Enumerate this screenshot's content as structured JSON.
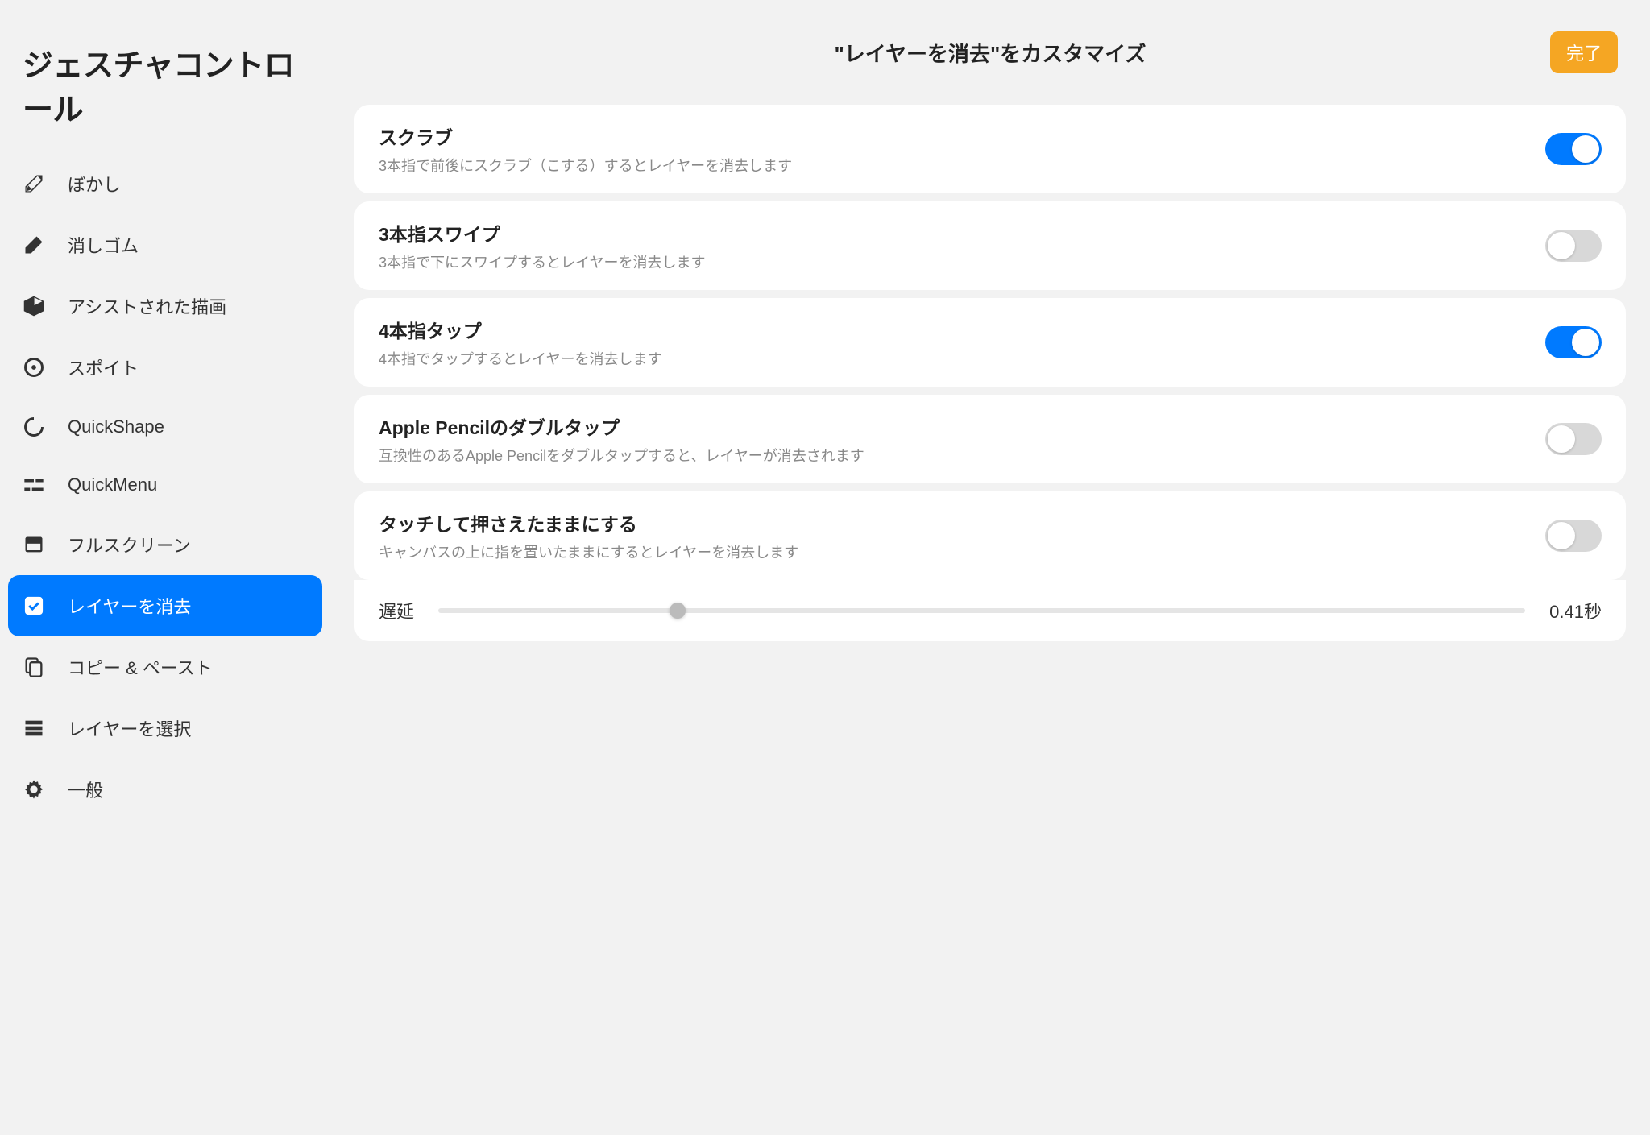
{
  "sidebar": {
    "title": "ジェスチャコントロール",
    "items": [
      {
        "id": "blur",
        "label": "ぼかし"
      },
      {
        "id": "eraser",
        "label": "消しゴム"
      },
      {
        "id": "assisted-draw",
        "label": "アシストされた描画"
      },
      {
        "id": "eyedropper",
        "label": "スポイト"
      },
      {
        "id": "quickshape",
        "label": "QuickShape"
      },
      {
        "id": "quickmenu",
        "label": "QuickMenu"
      },
      {
        "id": "fullscreen",
        "label": "フルスクリーン"
      },
      {
        "id": "clear-layer",
        "label": "レイヤーを消去",
        "active": true
      },
      {
        "id": "copy-paste",
        "label": "コピー & ペースト"
      },
      {
        "id": "select-layer",
        "label": "レイヤーを選択"
      },
      {
        "id": "general",
        "label": "一般"
      }
    ]
  },
  "header": {
    "title": "\"レイヤーを消去\"をカスタマイズ",
    "done": "完了"
  },
  "settings": [
    {
      "id": "scrub",
      "title": "スクラブ",
      "desc": "3本指で前後にスクラブ（こする）するとレイヤーを消去します",
      "on": true
    },
    {
      "id": "three-swipe",
      "title": "3本指スワイプ",
      "desc": "3本指で下にスワイプするとレイヤーを消去します",
      "on": false
    },
    {
      "id": "four-tap",
      "title": "4本指タップ",
      "desc": "4本指でタップするとレイヤーを消去します",
      "on": true
    },
    {
      "id": "pencil-doubletap",
      "title": "Apple Pencilのダブルタップ",
      "desc": "互換性のあるApple Pencilをダブルタップすると、レイヤーが消去されます",
      "on": false
    },
    {
      "id": "touch-hold",
      "title": "タッチして押さえたままにする",
      "desc": "キャンバスの上に指を置いたままにするとレイヤーを消去します",
      "on": false
    }
  ],
  "slider": {
    "label": "遅延",
    "value_text": "0.41秒",
    "percent": 22
  }
}
